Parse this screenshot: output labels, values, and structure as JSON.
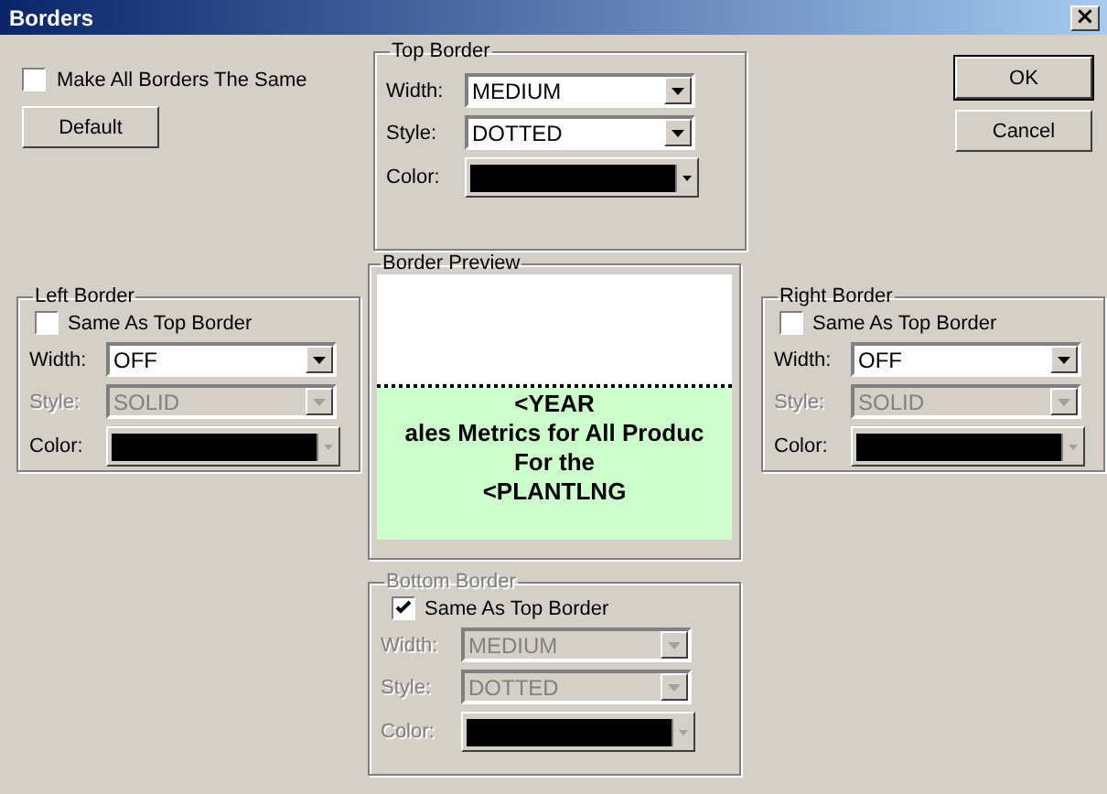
{
  "window": {
    "title": "Borders",
    "close": "×"
  },
  "make_all_same": {
    "label": "Make All Borders The Same",
    "checked": false
  },
  "default_button": "Default",
  "buttons": [
    {
      "label": "OK",
      "default": true
    },
    {
      "label": "Cancel",
      "default": false
    }
  ],
  "top_border": {
    "title": "Top Border",
    "disabled": false,
    "fields": [
      {
        "kind": "select",
        "label": "Width:",
        "value": "MEDIUM",
        "disabled": false
      },
      {
        "kind": "select",
        "label": "Style:",
        "value": "DOTTED",
        "disabled": false
      },
      {
        "kind": "color",
        "label": "Color:",
        "disabled": false
      }
    ]
  },
  "left_border": {
    "title": "Left Border",
    "disabled": false,
    "same_as_top": {
      "label": "Same As Top Border",
      "checked": false
    },
    "fields": [
      {
        "kind": "select",
        "label": "Width:",
        "value": "OFF",
        "disabled": false
      },
      {
        "kind": "select",
        "label": "Style:",
        "value": "SOLID",
        "disabled": true
      },
      {
        "kind": "color",
        "label": "Color:",
        "disabled": true
      }
    ]
  },
  "preview": {
    "title": "Border Preview",
    "lines": [
      "<YEAR",
      "ales Metrics for All Produc",
      "For the",
      "<PLANTLNG"
    ]
  },
  "right_border": {
    "title": "Right Border",
    "disabled": false,
    "same_as_top": {
      "label": "Same As Top Border",
      "checked": false
    },
    "fields": [
      {
        "kind": "select",
        "label": "Width:",
        "value": "OFF",
        "disabled": false
      },
      {
        "kind": "select",
        "label": "Style:",
        "value": "SOLID",
        "disabled": true
      },
      {
        "kind": "color",
        "label": "Color:",
        "disabled": true
      }
    ]
  },
  "bottom_border": {
    "title": "Bottom Border",
    "disabled": true,
    "same_as_top": {
      "label": "Same As Top Border",
      "checked": true
    },
    "fields": [
      {
        "kind": "select",
        "label": "Width:",
        "value": "MEDIUM",
        "disabled": true
      },
      {
        "kind": "select",
        "label": "Style:",
        "value": "DOTTED",
        "disabled": true
      },
      {
        "kind": "color",
        "label": "Color:",
        "disabled": true
      }
    ]
  }
}
